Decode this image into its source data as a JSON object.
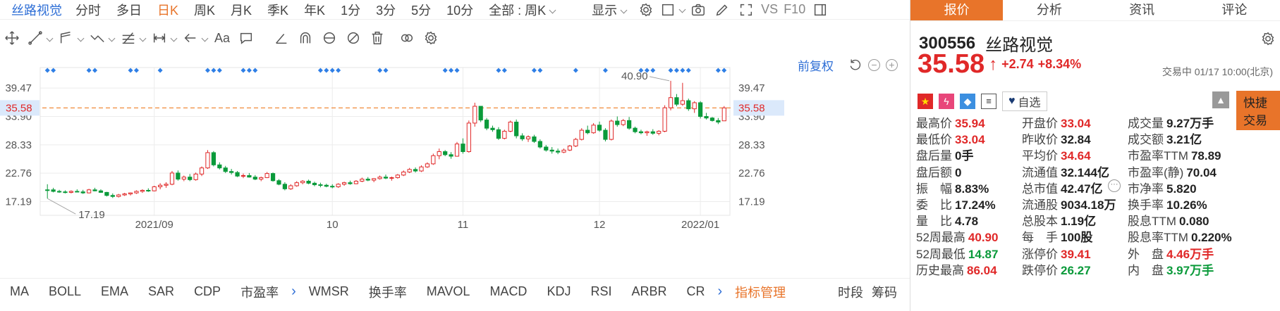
{
  "top_bar": {
    "stock_name": "丝路视觉",
    "periods": [
      "分时",
      "多日",
      "日K",
      "周K",
      "月K",
      "季K",
      "年K",
      "1分",
      "3分",
      "5分",
      "10分"
    ],
    "active_period": "日K",
    "scope_label": "全部 : 周K",
    "display_label": "显示",
    "vs_label": "VS",
    "f10_label": "F10"
  },
  "toolbar_icons": [
    "crosshair-move-icon",
    "line-tool-icon",
    "channel-tool-icon",
    "wave-tool-icon",
    "fibonacci-tool-icon",
    "range-tool-icon",
    "arrow-tool-icon",
    "text-tool-icon",
    "comment-tool-icon",
    "angle-tool-icon",
    "arc-tool-icon",
    "magnet-icon",
    "hide-icon",
    "delete-icon",
    "link-icon",
    "settings-icon"
  ],
  "toolbar_text_tool": "Aa",
  "chart": {
    "adjust_label": "前复权",
    "y_ticks": [
      "39.47",
      "33.90",
      "28.33",
      "22.76",
      "17.19"
    ],
    "current_price_tag": "35.58",
    "high_label": "40.90",
    "low_label": "17.19",
    "x_ticks": [
      "2021/09",
      "10",
      "11",
      "12",
      "2022/01"
    ],
    "colors": {
      "up": "#e02828",
      "down": "#0a9a3a",
      "ref_line": "#f08a3a",
      "grid": "#ececec"
    }
  },
  "chart_data": {
    "type": "candlestick",
    "y_range": [
      14.5,
      43.5
    ],
    "reference_price": 35.58,
    "candles": [
      [
        19.5,
        20.6,
        17.8,
        19.4
      ],
      [
        19.5,
        19.9,
        19.0,
        19.2
      ],
      [
        19.2,
        19.5,
        18.9,
        19.1
      ],
      [
        19.1,
        19.4,
        18.8,
        19.0
      ],
      [
        19.0,
        19.4,
        18.8,
        19.2
      ],
      [
        19.2,
        19.6,
        19.0,
        19.1
      ],
      [
        19.1,
        19.5,
        18.7,
        18.9
      ],
      [
        18.9,
        19.7,
        18.8,
        19.5
      ],
      [
        19.5,
        19.9,
        19.2,
        19.3
      ],
      [
        19.3,
        19.6,
        18.9,
        19.0
      ],
      [
        19.0,
        19.1,
        18.2,
        18.4
      ],
      [
        18.4,
        18.8,
        17.9,
        18.2
      ],
      [
        18.2,
        18.7,
        18.0,
        18.5
      ],
      [
        18.5,
        18.9,
        18.3,
        18.7
      ],
      [
        18.7,
        19.0,
        18.4,
        18.9
      ],
      [
        18.9,
        19.4,
        18.7,
        19.2
      ],
      [
        19.2,
        19.6,
        18.9,
        19.4
      ],
      [
        19.4,
        19.8,
        19.1,
        19.3
      ],
      [
        19.3,
        20.3,
        19.2,
        20.1
      ],
      [
        20.1,
        20.8,
        19.6,
        20.4
      ],
      [
        20.4,
        21.0,
        19.9,
        20.6
      ],
      [
        20.6,
        23.2,
        20.4,
        22.8
      ],
      [
        22.8,
        23.3,
        21.3,
        21.6
      ],
      [
        21.6,
        22.3,
        21.2,
        22.0
      ],
      [
        22.0,
        22.6,
        21.2,
        21.5
      ],
      [
        21.5,
        22.9,
        21.3,
        22.6
      ],
      [
        22.6,
        24.1,
        22.2,
        23.8
      ],
      [
        23.8,
        27.3,
        23.6,
        26.8
      ],
      [
        26.8,
        27.1,
        24.1,
        24.4
      ],
      [
        24.4,
        24.9,
        23.5,
        23.8
      ],
      [
        23.8,
        24.2,
        22.8,
        23.1
      ],
      [
        23.1,
        23.6,
        22.5,
        22.9
      ],
      [
        22.9,
        23.2,
        22.0,
        22.2
      ],
      [
        22.2,
        22.7,
        21.8,
        22.3
      ],
      [
        22.3,
        22.8,
        21.9,
        22.0
      ],
      [
        22.0,
        22.4,
        21.4,
        21.6
      ],
      [
        21.6,
        22.1,
        21.2,
        21.9
      ],
      [
        21.9,
        23.0,
        21.8,
        22.7
      ],
      [
        22.7,
        22.9,
        21.1,
        21.3
      ],
      [
        21.3,
        21.6,
        20.4,
        20.6
      ],
      [
        20.6,
        21.0,
        19.4,
        19.7
      ],
      [
        19.7,
        20.6,
        19.5,
        20.3
      ],
      [
        20.3,
        21.2,
        20.1,
        20.9
      ],
      [
        20.9,
        21.4,
        20.6,
        21.2
      ],
      [
        21.2,
        21.5,
        20.6,
        20.8
      ],
      [
        20.8,
        21.1,
        20.2,
        20.5
      ],
      [
        20.5,
        20.9,
        20.0,
        20.4
      ],
      [
        20.4,
        20.7,
        20.0,
        20.2
      ],
      [
        20.2,
        20.6,
        19.8,
        20.1
      ],
      [
        20.1,
        20.8,
        19.9,
        20.6
      ],
      [
        20.6,
        21.1,
        20.3,
        20.9
      ],
      [
        20.9,
        21.3,
        20.5,
        20.7
      ],
      [
        20.7,
        21.4,
        20.6,
        21.2
      ],
      [
        21.2,
        21.9,
        21.0,
        21.6
      ],
      [
        21.6,
        22.0,
        21.2,
        21.4
      ],
      [
        21.4,
        21.8,
        21.0,
        21.7
      ],
      [
        21.7,
        22.3,
        21.5,
        22.0
      ],
      [
        22.0,
        22.5,
        21.6,
        21.8
      ],
      [
        21.8,
        22.1,
        21.3,
        21.9
      ],
      [
        21.9,
        22.6,
        21.7,
        22.4
      ],
      [
        22.4,
        23.3,
        22.2,
        23.0
      ],
      [
        23.0,
        23.8,
        22.8,
        23.5
      ],
      [
        23.5,
        23.9,
        22.9,
        23.2
      ],
      [
        23.2,
        24.3,
        23.0,
        24.0
      ],
      [
        24.0,
        24.9,
        23.8,
        24.6
      ],
      [
        24.6,
        26.6,
        24.4,
        26.2
      ],
      [
        26.2,
        27.6,
        25.5,
        27.0
      ],
      [
        27.0,
        27.3,
        26.1,
        26.4
      ],
      [
        26.4,
        26.9,
        25.6,
        26.1
      ],
      [
        26.1,
        28.9,
        26.0,
        28.5
      ],
      [
        28.5,
        29.6,
        26.6,
        27.0
      ],
      [
        27.0,
        33.1,
        26.8,
        32.6
      ],
      [
        32.6,
        36.6,
        31.9,
        35.9
      ],
      [
        35.9,
        35.2,
        32.8,
        33.2
      ],
      [
        33.2,
        33.6,
        31.2,
        31.6
      ],
      [
        31.6,
        32.1,
        30.9,
        31.3
      ],
      [
        31.3,
        31.8,
        29.3,
        29.6
      ],
      [
        29.6,
        31.3,
        29.4,
        31.0
      ],
      [
        31.0,
        33.1,
        30.8,
        32.8
      ],
      [
        32.8,
        33.3,
        29.6,
        30.1
      ],
      [
        30.1,
        30.6,
        29.1,
        29.5
      ],
      [
        29.5,
        30.2,
        28.9,
        29.9
      ],
      [
        29.9,
        30.3,
        28.7,
        29.0
      ],
      [
        29.0,
        29.4,
        27.6,
        27.9
      ],
      [
        27.9,
        28.3,
        27.0,
        27.3
      ],
      [
        27.3,
        27.9,
        26.6,
        27.1
      ],
      [
        27.1,
        27.6,
        26.5,
        26.9
      ],
      [
        26.9,
        27.6,
        26.7,
        27.3
      ],
      [
        27.3,
        28.3,
        27.1,
        28.1
      ],
      [
        28.1,
        29.7,
        27.9,
        29.4
      ],
      [
        29.4,
        31.6,
        29.2,
        31.2
      ],
      [
        31.2,
        32.1,
        30.4,
        30.7
      ],
      [
        30.7,
        32.6,
        30.5,
        32.2
      ],
      [
        32.2,
        32.9,
        30.9,
        31.2
      ],
      [
        31.2,
        31.6,
        29.0,
        29.4
      ],
      [
        29.4,
        33.3,
        29.2,
        33.0
      ],
      [
        33.0,
        33.9,
        31.9,
        32.3
      ],
      [
        32.3,
        33.4,
        32.0,
        33.1
      ],
      [
        33.1,
        33.8,
        31.3,
        31.6
      ],
      [
        31.6,
        31.9,
        30.6,
        30.9
      ],
      [
        30.9,
        31.3,
        30.4,
        30.7
      ],
      [
        30.7,
        31.1,
        30.1,
        30.9
      ],
      [
        30.9,
        31.4,
        30.3,
        30.6
      ],
      [
        30.6,
        31.2,
        30.2,
        31.0
      ],
      [
        31.0,
        36.1,
        30.8,
        35.6
      ],
      [
        35.6,
        40.9,
        35.1,
        37.6
      ],
      [
        37.6,
        38.3,
        35.9,
        36.3
      ],
      [
        36.3,
        40.5,
        36.0,
        37.0
      ],
      [
        37.0,
        37.4,
        35.0,
        35.4
      ],
      [
        35.4,
        36.9,
        34.6,
        36.6
      ],
      [
        36.6,
        36.9,
        33.5,
        33.9
      ],
      [
        33.9,
        34.6,
        33.3,
        33.6
      ],
      [
        33.6,
        33.8,
        32.9,
        33.1
      ],
      [
        33.1,
        33.6,
        32.4,
        32.8
      ],
      [
        33.04,
        35.94,
        33.04,
        35.58
      ]
    ]
  },
  "indicators": {
    "main": [
      "MA",
      "BOLL",
      "EMA",
      "SAR",
      "CDP",
      "市盈率"
    ],
    "sub": [
      "WMSR",
      "换手率",
      "MAVOL",
      "MACD",
      "KDJ",
      "RSI",
      "ARBR",
      "CR"
    ],
    "manage": "指标管理",
    "right": [
      "时段",
      "筹码"
    ]
  },
  "right_panel": {
    "tabs": [
      "报价",
      "分析",
      "资讯",
      "评论"
    ],
    "active_tab": "报价",
    "code": "300556",
    "name": "丝路视觉",
    "price": "35.58",
    "change": "+2.74",
    "change_pct": "+8.34%",
    "status": "交易中 01/17 10:00(北京)",
    "watchlist_label": "自选",
    "trade_button": "快捷交易",
    "quotes": [
      [
        {
          "label": "最高价",
          "value": "35.94",
          "color": "red"
        },
        {
          "label": "开盘价",
          "value": "33.04",
          "color": "red"
        },
        {
          "label": "成交量",
          "value": "9.27万手",
          "color": "dark"
        }
      ],
      [
        {
          "label": "最低价",
          "value": "33.04",
          "color": "red"
        },
        {
          "label": "昨收价",
          "value": "32.84",
          "color": "dark"
        },
        {
          "label": "成交额",
          "value": "3.21亿",
          "color": "dark"
        }
      ],
      [
        {
          "label": "盘后量",
          "value": "0手",
          "color": "dark"
        },
        {
          "label": "平均价",
          "value": "34.64",
          "color": "red"
        },
        {
          "label": "市盈率TTM",
          "value": "78.89",
          "color": "dark"
        }
      ],
      [
        {
          "label": "盘后额",
          "value": "0",
          "color": "dark"
        },
        {
          "label": "流通值",
          "value": "32.144亿",
          "color": "dark"
        },
        {
          "label": "市盈率(静)",
          "value": "70.04",
          "color": "dark"
        }
      ],
      [
        {
          "label": "振　幅",
          "value": "8.83%",
          "color": "dark"
        },
        {
          "label": "总市值",
          "value": "42.47亿",
          "color": "dark"
        },
        {
          "label": "市净率",
          "value": "5.820",
          "color": "dark"
        }
      ],
      [
        {
          "label": "委　比",
          "value": "17.24%",
          "color": "dark"
        },
        {
          "label": "流通股",
          "value": "9034.18万",
          "color": "dark"
        },
        {
          "label": "换手率",
          "value": "10.26%",
          "color": "dark"
        }
      ],
      [
        {
          "label": "量　比",
          "value": "4.78",
          "color": "dark"
        },
        {
          "label": "总股本",
          "value": "1.19亿",
          "color": "dark"
        },
        {
          "label": "股息TTM",
          "value": "0.080",
          "color": "dark"
        }
      ],
      [
        {
          "label": "52周最高",
          "value": "40.90",
          "color": "red"
        },
        {
          "label": "每　手",
          "value": "100股",
          "color": "dark"
        },
        {
          "label": "股息率TTM",
          "value": "0.220%",
          "color": "dark"
        }
      ],
      [
        {
          "label": "52周最低",
          "value": "14.87",
          "color": "green"
        },
        {
          "label": "涨停价",
          "value": "39.41",
          "color": "red"
        },
        {
          "label": "外　盘",
          "value": "4.46万手",
          "color": "red"
        }
      ],
      [
        {
          "label": "历史最高",
          "value": "86.04",
          "color": "red"
        },
        {
          "label": "跌停价",
          "value": "26.27",
          "color": "green"
        },
        {
          "label": "内　盘",
          "value": "3.97万手",
          "color": "green"
        }
      ]
    ]
  }
}
